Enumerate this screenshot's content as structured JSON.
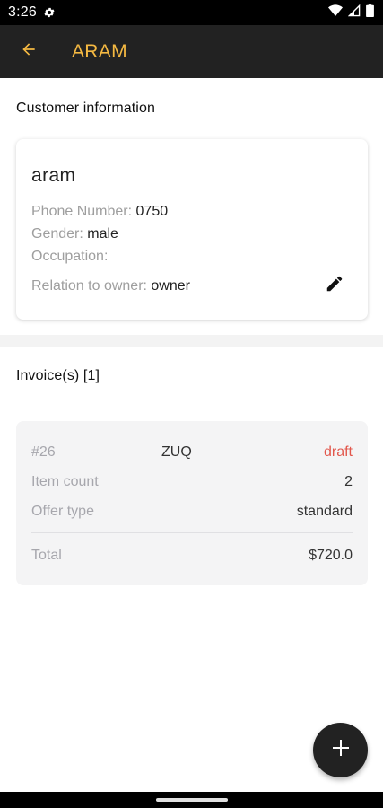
{
  "status_bar": {
    "time": "3:26"
  },
  "app_bar": {
    "title": "ARAM"
  },
  "customer_section": {
    "title": "Customer information"
  },
  "customer": {
    "name": "aram",
    "phone_label": "Phone Number: ",
    "phone_value": "0750",
    "gender_label": "Gender: ",
    "gender_value": "male",
    "occupation_label": "Occupation: ",
    "occupation_value": "",
    "relation_label": "Relation to owner: ",
    "relation_value": "owner"
  },
  "invoices_section": {
    "title": "Invoice(s) [1]"
  },
  "invoices": [
    {
      "number": "#26",
      "code": "ZUQ",
      "status": "draft",
      "item_count_label": "Item count",
      "item_count": "2",
      "offer_type_label": "Offer type",
      "offer_type": "standard",
      "total_label": "Total",
      "total": "$720.0"
    }
  ],
  "colors": {
    "accent": "#f5b942",
    "app_bar": "#222222",
    "status_draft": "#e2574c"
  },
  "icons": {
    "back": "arrow-back-icon",
    "edit": "pencil-icon",
    "fab": "plus-icon"
  }
}
